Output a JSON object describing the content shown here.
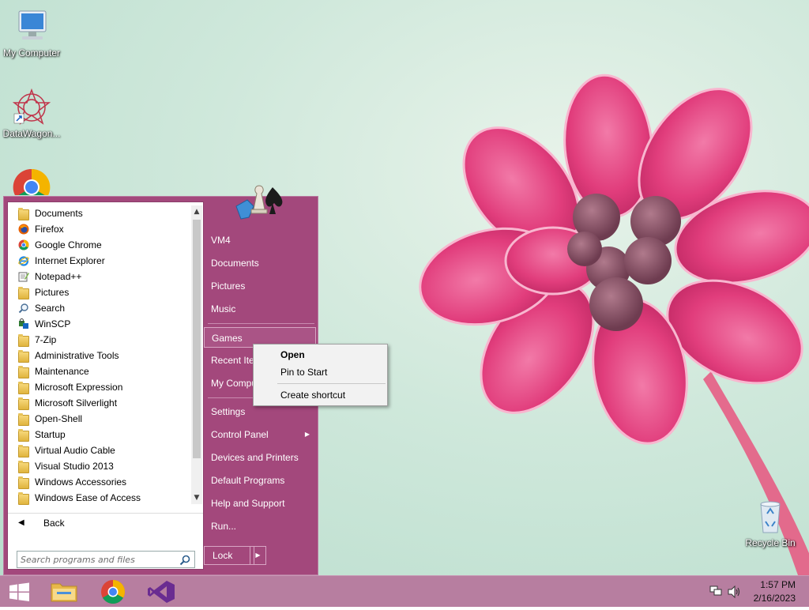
{
  "desktop": {
    "icons": [
      {
        "label": "My Computer",
        "icon": "computer-icon"
      },
      {
        "label": "DataWagon...",
        "icon": "datawagon-icon"
      },
      {
        "label": "",
        "icon": "chrome-icon"
      },
      {
        "label": "Recycle Bin",
        "icon": "recycle-bin-icon"
      }
    ]
  },
  "start_menu": {
    "programs": [
      {
        "label": "Documents",
        "icon": "folder-icon"
      },
      {
        "label": "Firefox",
        "icon": "firefox-icon"
      },
      {
        "label": "Google Chrome",
        "icon": "chrome-icon"
      },
      {
        "label": "Internet Explorer",
        "icon": "ie-icon"
      },
      {
        "label": "Notepad++",
        "icon": "notepadpp-icon"
      },
      {
        "label": "Pictures",
        "icon": "folder-icon"
      },
      {
        "label": "Search",
        "icon": "search-icon"
      },
      {
        "label": "WinSCP",
        "icon": "winscp-icon"
      },
      {
        "label": "7-Zip",
        "icon": "folder-icon"
      },
      {
        "label": "Administrative Tools",
        "icon": "folder-icon"
      },
      {
        "label": "Maintenance",
        "icon": "folder-icon"
      },
      {
        "label": "Microsoft Expression",
        "icon": "folder-icon"
      },
      {
        "label": "Microsoft Silverlight",
        "icon": "folder-icon"
      },
      {
        "label": "Open-Shell",
        "icon": "folder-icon"
      },
      {
        "label": "Startup",
        "icon": "folder-icon"
      },
      {
        "label": "Virtual Audio Cable",
        "icon": "folder-icon"
      },
      {
        "label": "Visual Studio 2013",
        "icon": "folder-icon"
      },
      {
        "label": "Windows Accessories",
        "icon": "folder-icon"
      },
      {
        "label": "Windows Ease of Access",
        "icon": "folder-icon"
      }
    ],
    "back_label": "Back",
    "search_placeholder": "Search programs and files",
    "right_items": {
      "vm4": "VM4",
      "documents": "Documents",
      "pictures": "Pictures",
      "music": "Music",
      "games": "Games",
      "recent_items": "Recent Items",
      "my_computer": "My Computer",
      "settings": "Settings",
      "control_panel": "Control Panel",
      "devices_printers": "Devices and Printers",
      "default_programs": "Default Programs",
      "help_support": "Help and Support",
      "run": "Run..."
    },
    "lock_label": "Lock"
  },
  "context_menu": {
    "open": "Open",
    "pin_to_start": "Pin to Start",
    "create_shortcut": "Create shortcut"
  },
  "taskbar": {
    "pinned": [
      "file-explorer-icon",
      "chrome-icon",
      "visual-studio-icon"
    ],
    "clock_time": "1:57 PM",
    "clock_date": "2/16/2023"
  },
  "colors": {
    "start_menu_bg": "#a3487c",
    "taskbar_bg": "#b77ea0",
    "flower": "#e0457f"
  }
}
